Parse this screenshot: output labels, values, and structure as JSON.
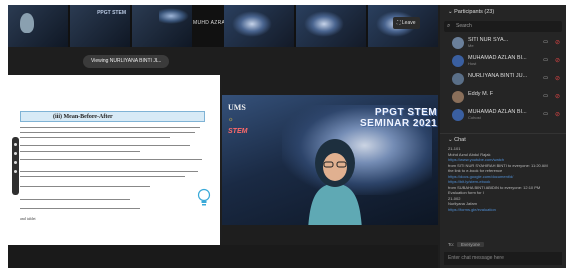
{
  "thumbnails": {
    "speaker_name": "MUHD AZRAI BIN MOH...",
    "seminar_label": "PPGT STEM"
  },
  "exit_button": "⛶ Leave",
  "viewing_label": "Viewing NURLIYANA BINTI JL..",
  "document": {
    "section_title": "(iii) Mean-Before-After",
    "footer_text": "and tablet"
  },
  "video": {
    "logo_ums": "UMS",
    "logo_stem": "STEM",
    "seminar_line1": "PPGT STEM",
    "seminar_line2": "SEMINAR 2021"
  },
  "participants": {
    "header": "Participants (23)",
    "search_placeholder": "Search",
    "list": [
      {
        "name": "SITI NUR SYA...",
        "sub": "Me",
        "avatar_color": "#6a7f9a"
      },
      {
        "name": "MUHAMAD AZLAN BI...",
        "sub": "Host",
        "avatar_color": "#3a5fa0"
      },
      {
        "name": "NURLIYANA BINTI JU...",
        "sub": "",
        "avatar_color": "#5a6f88"
      },
      {
        "name": "Eddy M. F",
        "sub": "",
        "avatar_color": "#8a6f5a"
      },
      {
        "name": "MUHAMAD AZLAN BI...",
        "sub": "Cohost",
        "avatar_color": "#3a5fa0"
      }
    ]
  },
  "chat": {
    "header": "Chat",
    "messages": [
      {
        "text": "21-101"
      },
      {
        "text": "Mohd Azrul Abdul Rajak"
      },
      {
        "text": "https://www.youtube.com/watch",
        "link": true
      },
      {
        "text": "from SITI NUR SYAHIRAH BINTI to everyone: 11:20 AM"
      },
      {
        "text": "the link to e-book for reference"
      },
      {
        "text": "https://docs.google.com/document/d/",
        "link": true
      },
      {
        "text": "https://bit.ly/stem-ebook",
        "link": true
      },
      {
        "text": "from SUBAHA BINTI ABIDIN to everyone: 12:10 PM"
      },
      {
        "text": "Evaluation form for I"
      },
      {
        "text": "21-002"
      },
      {
        "text": "Nurliyana Jafam"
      },
      {
        "text": "https://forms.gle/evaluation",
        "link": true
      }
    ],
    "to_label": "To:",
    "to_value": "Everyone",
    "input_placeholder": "Enter chat message here"
  }
}
